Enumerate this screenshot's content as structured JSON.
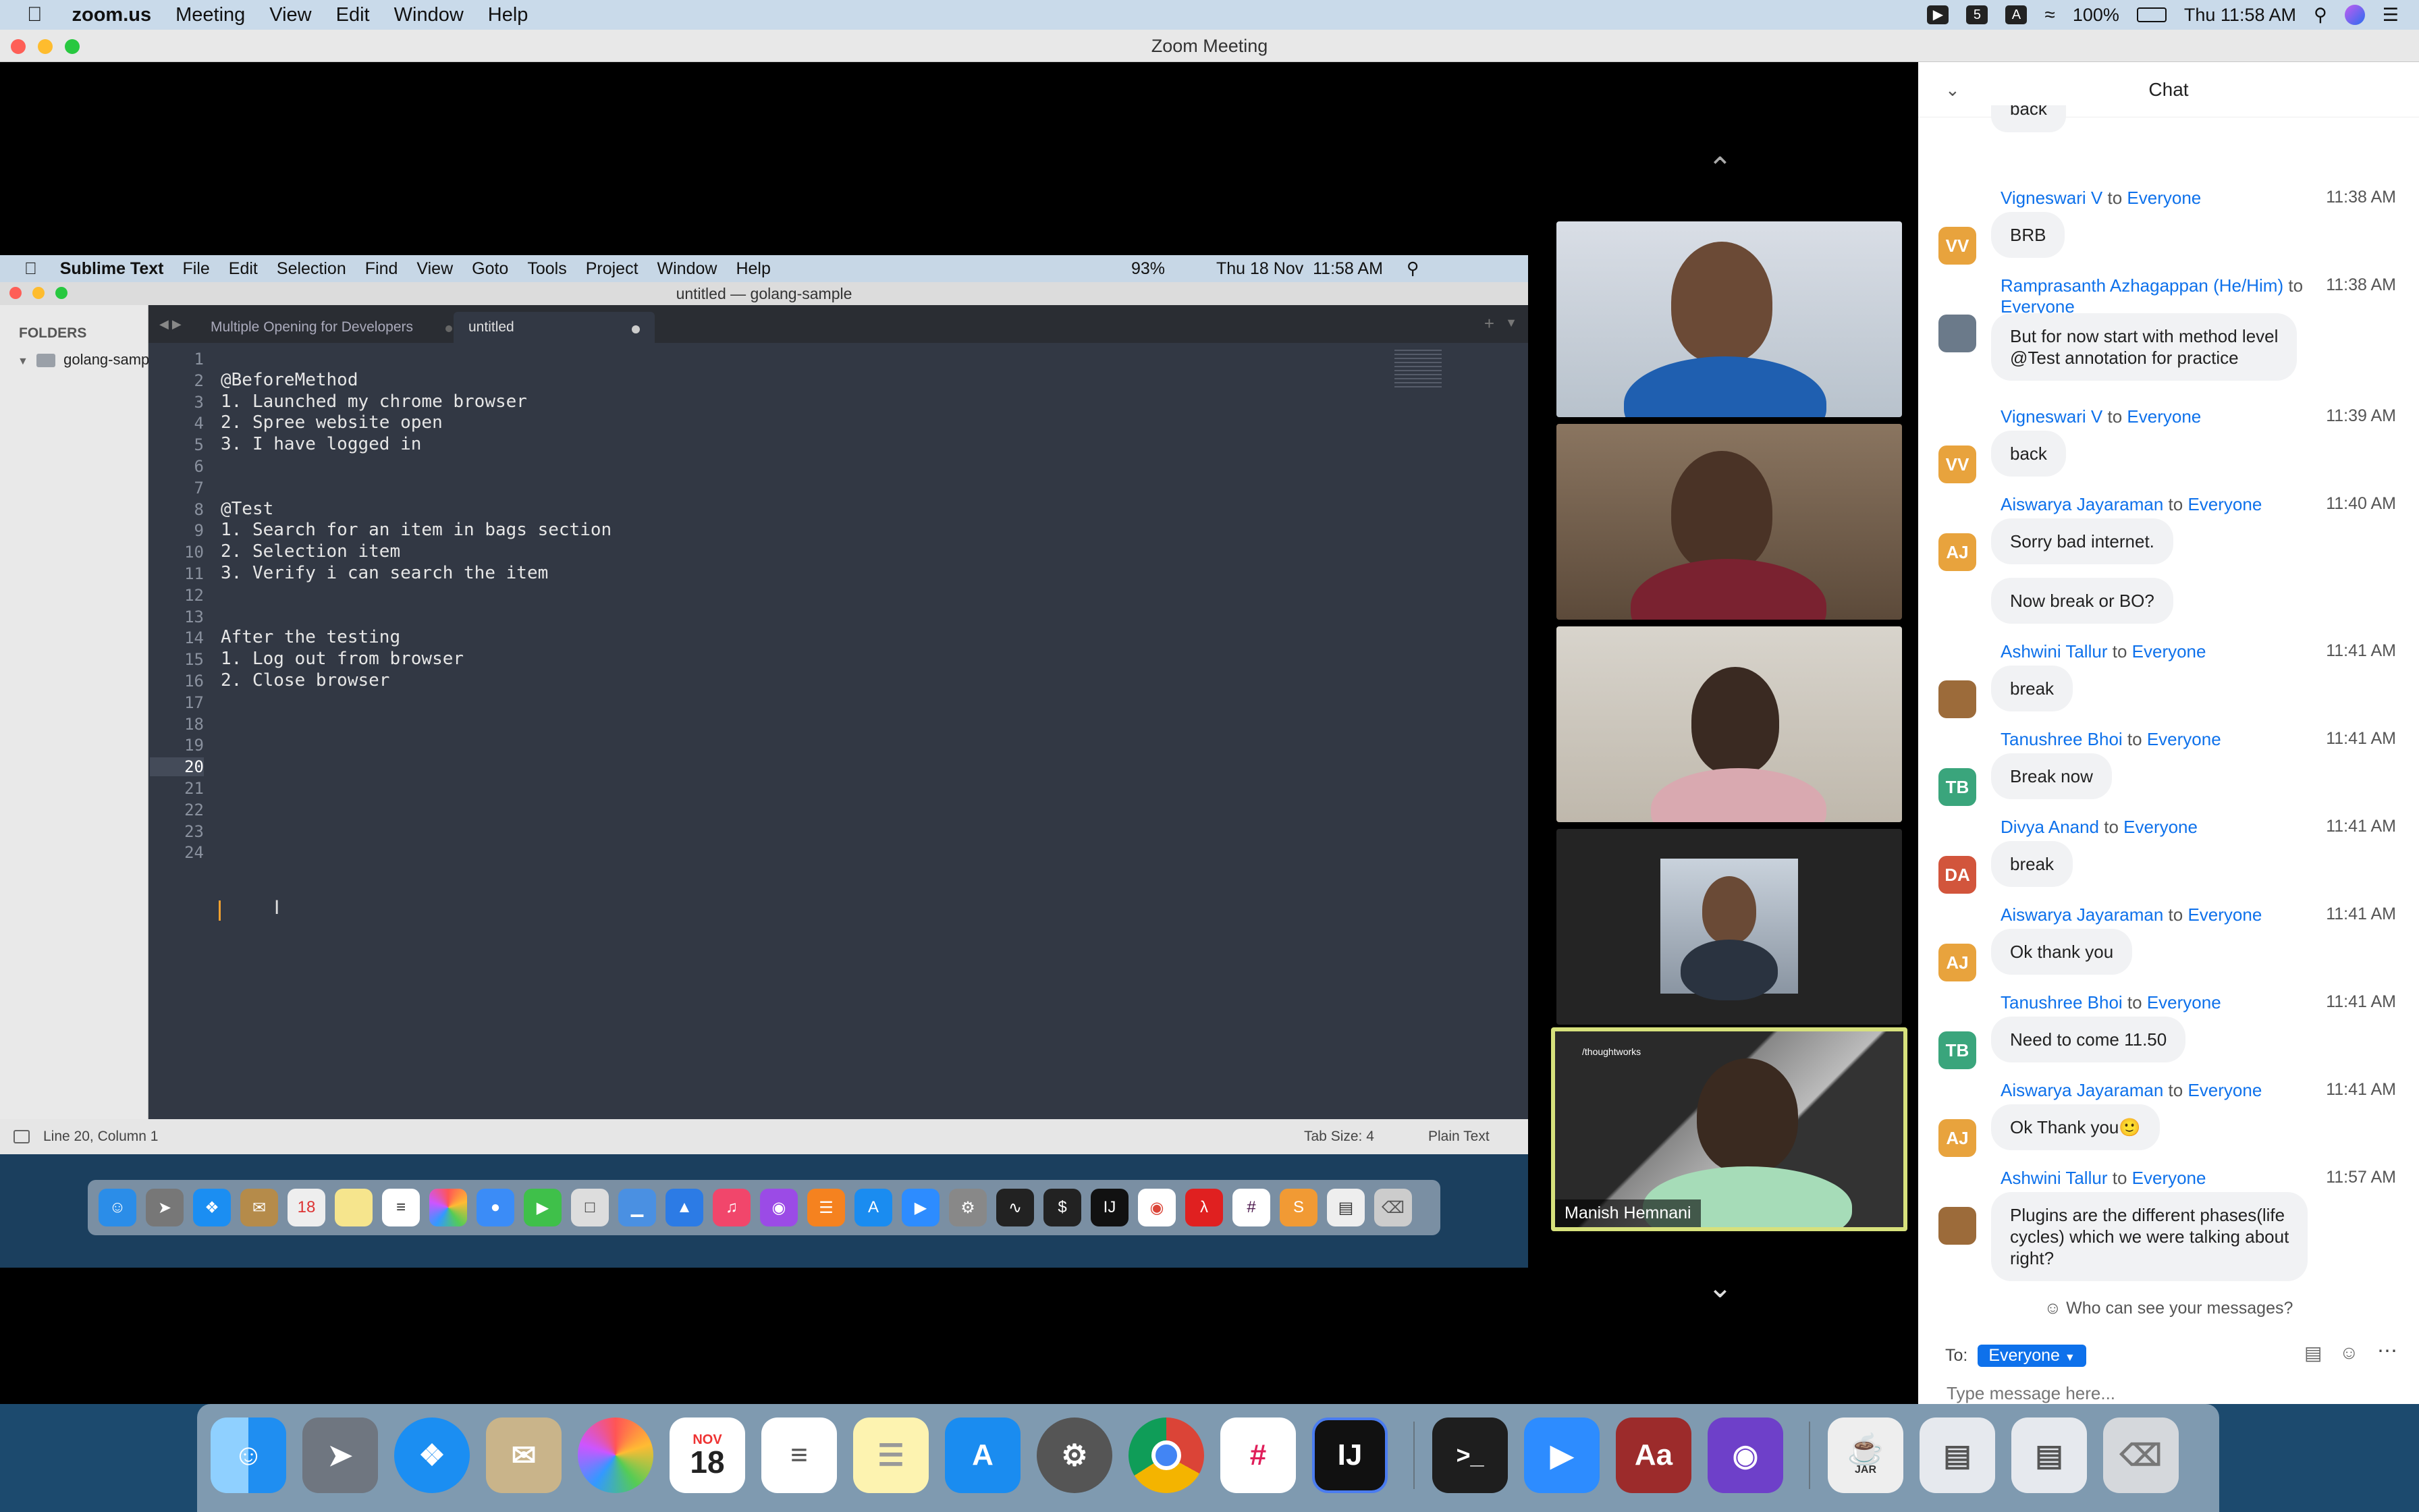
{
  "menubar": {
    "app": "zoom.us",
    "items": [
      "Meeting",
      "View",
      "Edit",
      "Window",
      "Help"
    ],
    "battery": "100%",
    "clock": "Thu 11:58 AM"
  },
  "zoom_window": {
    "title": "Zoom Meeting"
  },
  "shared_screen": {
    "menubar": {
      "app": "Sublime Text",
      "items": [
        "File",
        "Edit",
        "Selection",
        "Find",
        "View",
        "Goto",
        "Tools",
        "Project",
        "Window",
        "Help"
      ],
      "battery": "93%",
      "clock": "Thu 18 Nov  11:58 AM"
    },
    "window_title": "untitled — golang-sample",
    "sidebar": {
      "header": "FOLDERS",
      "folder": "golang-samp"
    },
    "tabs": [
      {
        "label": "Multiple Opening for Developers",
        "active": false
      },
      {
        "label": "untitled",
        "active": true
      }
    ],
    "editor": {
      "line_numbers": [
        "1",
        "2",
        "3",
        "4",
        "5",
        "6",
        "7",
        "8",
        "9",
        "10",
        "11",
        "12",
        "13",
        "14",
        "15",
        "16",
        "17",
        "18",
        "19",
        "20",
        "21",
        "22",
        "23",
        "24"
      ],
      "lines": [
        "",
        "@BeforeMethod",
        "1. Launched my chrome browser",
        "2. Spree website open",
        "3. I have logged in",
        "",
        "",
        "@Test",
        "1. Search for an item in bags section",
        "2. Selection item",
        "3. Verify i can search the item",
        "",
        "",
        "After the testing",
        "1. Log out from browser",
        "2. Close browser",
        "",
        "",
        "",
        "",
        "",
        "",
        "",
        ""
      ],
      "current_line": 20
    },
    "statusbar": {
      "position": "Line 20, Column 1",
      "tab_size": "Tab Size: 4",
      "syntax": "Plain Text"
    }
  },
  "participants": [
    {
      "name": ""
    },
    {
      "name": ""
    },
    {
      "name": ""
    },
    {
      "name": ""
    },
    {
      "name": "Manish Hemnani",
      "speaking": true,
      "logo_text": "/thoughtworks"
    }
  ],
  "chat": {
    "title": "Chat",
    "partial_top_message": "back",
    "messages": [
      {
        "sender": "Vigneswari V",
        "to": "to",
        "audience": "Everyone",
        "time": "11:38 AM",
        "initials": "VV",
        "color": "#e8a33d",
        "bubbles": [
          "BRB"
        ]
      },
      {
        "sender": "Ramprasanth Azhagappan (He/Him)",
        "to": "to",
        "audience": "Everyone",
        "time": "11:38 AM",
        "initials": "",
        "color": "#6b7a8a",
        "bubbles": [
          "But for now start with method level\n@Test annotation for practice"
        ]
      },
      {
        "sender": "Vigneswari V",
        "to": "to",
        "audience": "Everyone",
        "time": "11:39 AM",
        "initials": "VV",
        "color": "#e8a33d",
        "bubbles": [
          "back"
        ]
      },
      {
        "sender": "Aiswarya Jayaraman",
        "to": "to",
        "audience": "Everyone",
        "time": "11:40 AM",
        "initials": "AJ",
        "color": "#e8a33d",
        "bubbles": [
          "Sorry bad internet.",
          "Now break or BO?"
        ]
      },
      {
        "sender": "Ashwini Tallur",
        "to": "to",
        "audience": "Everyone",
        "time": "11:41 AM",
        "initials": "",
        "color": "#9c6b3a",
        "bubbles": [
          "break"
        ]
      },
      {
        "sender": "Tanushree Bhoi",
        "to": "to",
        "audience": "Everyone",
        "time": "11:41 AM",
        "initials": "TB",
        "color": "#3aa57c",
        "bubbles": [
          "Break now"
        ]
      },
      {
        "sender": "Divya Anand",
        "to": "to",
        "audience": "Everyone",
        "time": "11:41 AM",
        "initials": "DA",
        "color": "#d2553c",
        "bubbles": [
          "break"
        ]
      },
      {
        "sender": "Aiswarya Jayaraman",
        "to": "to",
        "audience": "Everyone",
        "time": "11:41 AM",
        "initials": "AJ",
        "color": "#e8a33d",
        "bubbles": [
          "Ok thank you"
        ]
      },
      {
        "sender": "Tanushree Bhoi",
        "to": "to",
        "audience": "Everyone",
        "time": "11:41 AM",
        "initials": "TB",
        "color": "#3aa57c",
        "bubbles": [
          "Need to come 11.50"
        ]
      },
      {
        "sender": "Aiswarya Jayaraman",
        "to": "to",
        "audience": "Everyone",
        "time": "11:41 AM",
        "initials": "AJ",
        "color": "#e8a33d",
        "bubbles": [
          "Ok Thank you🙂"
        ]
      },
      {
        "sender": "Ashwini Tallur",
        "to": "to",
        "audience": "Everyone",
        "time": "11:57 AM",
        "initials": "",
        "color": "#9c6b3a",
        "bubbles": [
          "Plugins are the different phases(life\ncycles) which we were talking about\nright?"
        ]
      }
    ],
    "visibility_note": "Who can see your messages?",
    "to_label": "To:",
    "recipient": "Everyone",
    "input_placeholder": "Type message here..."
  },
  "dock": {
    "apps": [
      "Finder",
      "Launchpad",
      "Safari",
      "Mail",
      "Photos",
      "Calendar",
      "Reminders",
      "Notes",
      "App Store",
      "System Preferences",
      "Chrome",
      "Slack",
      "IntelliJ IDEA",
      "Terminal",
      "Zoom",
      "Dictionary",
      "GitHub Desktop",
      "Java Launcher",
      "Finder Window",
      "Finder Window",
      "Trash"
    ],
    "calendar_month": "NOV",
    "calendar_day": "18",
    "intellij_label": "IJ",
    "dictionary_label": "Aa",
    "jar_label": "JAR"
  }
}
